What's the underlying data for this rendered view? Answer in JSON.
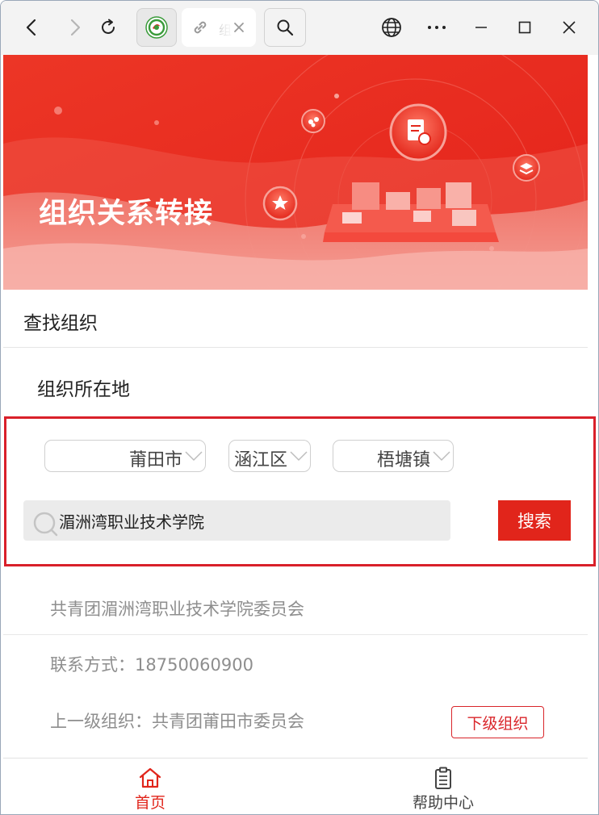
{
  "browser": {
    "tab_title": "组"
  },
  "banner": {
    "title": "组织关系转接"
  },
  "find_section": {
    "title": "查找组织",
    "location_label": "组织所在地"
  },
  "filters": {
    "city": "莆田市",
    "district": "涵江区",
    "town": "梧塘镇"
  },
  "search": {
    "value": "湄洲湾职业技术学院",
    "button_label": "搜索"
  },
  "result": {
    "org_name": "共青团湄洲湾职业技术学院委员会",
    "contact": "联系方式：18750060900",
    "parent_org": "上一级组织：共青团莆田市委员会",
    "sub_org_button": "下级组织"
  },
  "bottom_nav": {
    "home_label": "首页",
    "help_label": "帮助中心"
  },
  "colors": {
    "brand_red": "#e1251b",
    "highlight_border": "#d9202a",
    "muted_text": "#8e8e8e"
  }
}
